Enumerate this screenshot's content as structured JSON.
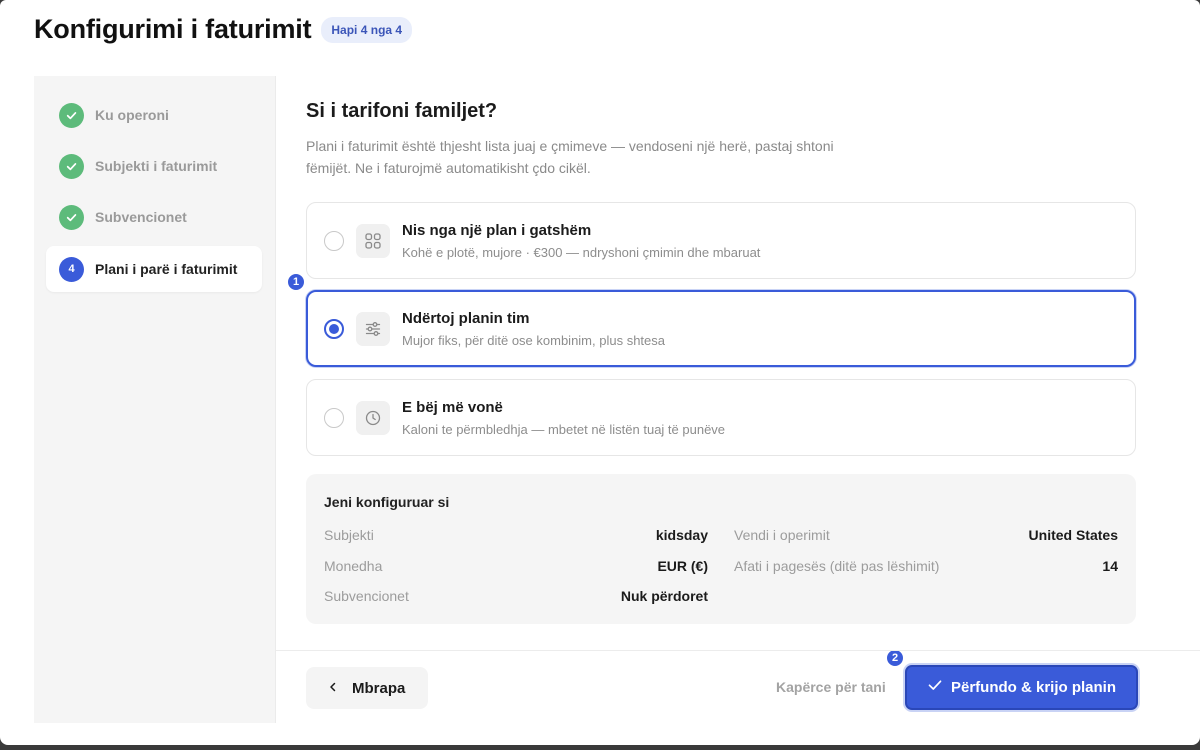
{
  "header": {
    "title": "Konfigurimi i faturimit",
    "step_badge": "Hapi 4 nga 4"
  },
  "sidebar": {
    "steps": [
      {
        "label": "Ku operoni",
        "status": "done"
      },
      {
        "label": "Subjekti i faturimit",
        "status": "done"
      },
      {
        "label": "Subvencionet",
        "status": "done"
      },
      {
        "label": "Plani i parë i faturimit",
        "status": "current",
        "number": "4"
      }
    ]
  },
  "main": {
    "title": "Si i tarifoni familjet?",
    "subtitle": "Plani i faturimit është thjesht lista juaj e çmimeve — vendoseni një herë, pastaj shtoni fëmijët. Ne i faturojmë automatikisht çdo cikël."
  },
  "options": [
    {
      "title": "Nis nga një plan i gatshëm",
      "description": "Kohë e plotë, mujore · €300 — ndryshoni çmimin dhe mbaruat",
      "icon": "grid-icon",
      "selected": false
    },
    {
      "title": "Ndërtoj planin tim",
      "description": "Mujor fiks, për ditë ose kombinim, plus shtesa",
      "icon": "sliders-icon",
      "selected": true
    },
    {
      "title": "E bëj më vonë",
      "description": "Kaloni te përmbledhja — mbetet në listën tuaj të punëve",
      "icon": "clock-icon",
      "selected": false
    }
  ],
  "summary": {
    "title": "Jeni konfiguruar si",
    "left": [
      {
        "label": "Subjekti",
        "value": "kidsday"
      },
      {
        "label": "Monedha",
        "value": "EUR (€)"
      },
      {
        "label": "Subvencionet",
        "value": "Nuk përdoret"
      }
    ],
    "right": [
      {
        "label": "Vendi i operimit",
        "value": "United States"
      },
      {
        "label": "Afati i pagesës (ditë pas lëshimit)",
        "value": "14"
      }
    ]
  },
  "footer": {
    "back_label": "Mbrapa",
    "skip_label": "Kapërce për tani",
    "finish_label": "Përfundo & krijo planin"
  },
  "markers": [
    "1",
    "2"
  ],
  "colors": {
    "accent": "#3a5bd9",
    "success": "#5dbb7b"
  }
}
